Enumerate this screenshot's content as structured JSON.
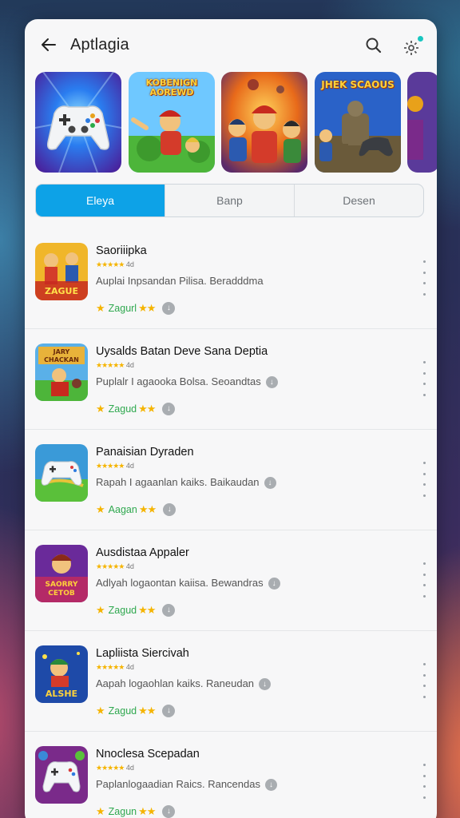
{
  "header": {
    "title": "Aptlagia"
  },
  "banners": [
    {
      "text": ""
    },
    {
      "text": "KOBENIGN AOREWD"
    },
    {
      "text": ""
    },
    {
      "text": "JHEK SCAOUS"
    },
    {
      "text": ""
    }
  ],
  "tabs": [
    {
      "label": "Eleya",
      "active": true
    },
    {
      "label": "Banp",
      "active": false
    },
    {
      "label": "Desen",
      "active": false
    }
  ],
  "apps": [
    {
      "name": "Saoriiipka",
      "rating_text": "4d",
      "description": "Auplai Inpsandan Pilisa. Beradddma",
      "show_desc_icon": false,
      "tag": "Zagurl",
      "icon_text": "ZAGUE"
    },
    {
      "name": "Uysalds Batan Deve Sana Deptia",
      "rating_text": "4d",
      "description": "Puplalr I agaooka Bolsa. Seoandtas",
      "show_desc_icon": true,
      "tag": "Zagud",
      "icon_text": "JARY CHACKAN"
    },
    {
      "name": "Panaisian Dyraden",
      "rating_text": "4d",
      "description": "Rapah I agaanlan kaiks. Baikaudan",
      "show_desc_icon": true,
      "tag": "Aagan",
      "icon_text": ""
    },
    {
      "name": "Ausdistaa Appaler",
      "rating_text": "4d",
      "description": "Adlyah logaontan kaiisa. Bewandras",
      "show_desc_icon": true,
      "tag": "Zagud",
      "icon_text": "SAORRY CETOB"
    },
    {
      "name": "Lapliista Siercivah",
      "rating_text": "4d",
      "description": "Aapah logaohlan kaiks. Raneudan",
      "show_desc_icon": true,
      "tag": "Zagud",
      "icon_text": "ALSHE"
    },
    {
      "name": "Nnoclesa Scepadan",
      "rating_text": "4d",
      "description": "Paplanlogaadian Raics. Rancendas",
      "show_desc_icon": true,
      "tag": "Zagun",
      "icon_text": ""
    }
  ],
  "colors": {
    "accent": "#0da2e7",
    "tag_green": "#2fa84f",
    "star": "#f5b400",
    "notification": "#19c6c0"
  },
  "icons": {
    "back": "arrow-left-icon",
    "search": "search-icon",
    "settings": "gear-icon",
    "download": "download-icon",
    "more": "more-vertical-icon"
  }
}
